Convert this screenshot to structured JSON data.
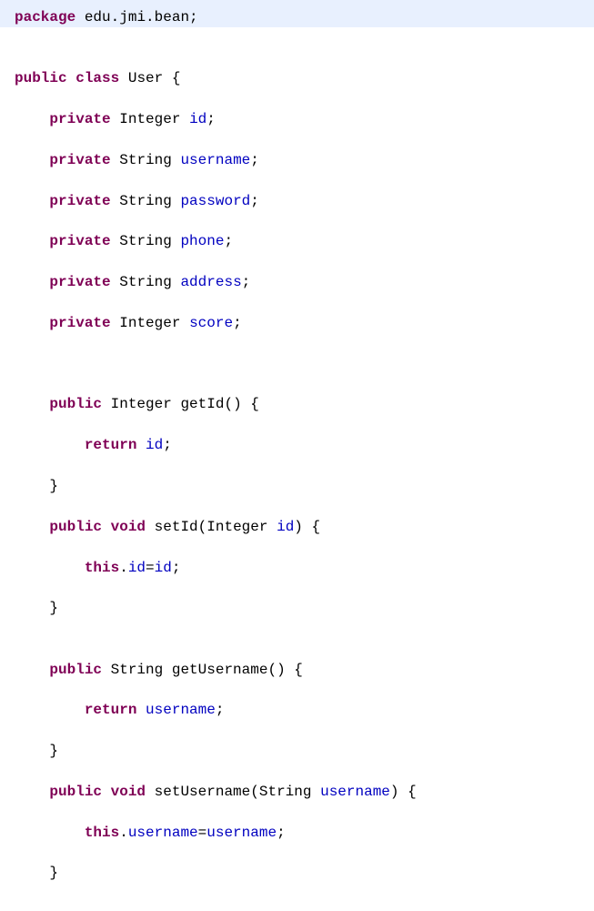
{
  "code": {
    "package_kw": "package",
    "package_name": "edu.jmi.bean",
    "public_kw": "public",
    "class_kw": "class",
    "class_name": "User",
    "private_kw": "private",
    "void_kw": "void",
    "return_kw": "return",
    "this_kw": "this",
    "types": {
      "Integer": "Integer",
      "String": "String"
    },
    "fields": {
      "id": "id",
      "username": "username",
      "password": "password",
      "phone": "phone",
      "address": "address",
      "score": "score"
    },
    "methods": {
      "getId": "getId",
      "setId": "setId",
      "getUsername": "getUsername",
      "setUsername": "setUsername"
    },
    "params": {
      "id": "id",
      "username": "username"
    }
  }
}
